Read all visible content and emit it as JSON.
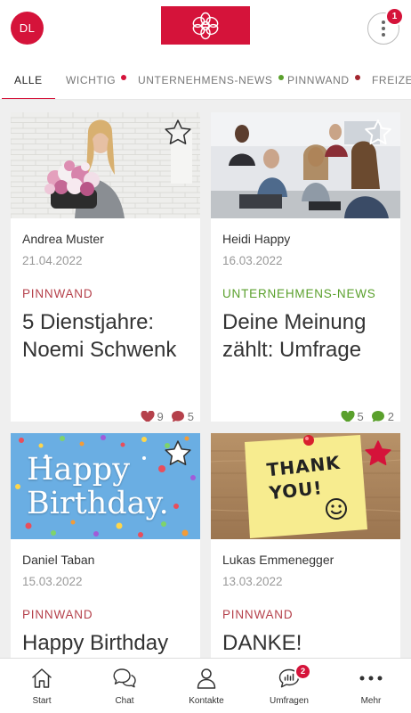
{
  "header": {
    "avatar_initials": "DL",
    "menu_badge": "1",
    "brand_color": "#d5133a"
  },
  "tabs": [
    {
      "label": "ALLE",
      "active": true
    },
    {
      "label": "WICHTIG",
      "dot_color": "#d5133a"
    },
    {
      "label": "UNTERNEHMENS-NEWS",
      "dot_color": "#5aa02c"
    },
    {
      "label": "PINNWAND",
      "dot_color": "#a3262f"
    },
    {
      "label": "FREIZEIT"
    }
  ],
  "posts": [
    {
      "author": "Andrea Muster",
      "date": "21.04.2022",
      "category": "PINNWAND",
      "category_color": "#b5414b",
      "title": "5 Dienstjahre: Noemi Schwenk",
      "likes": "9",
      "comments": "5",
      "reaction_color": "#b5414b",
      "starred": false,
      "image": "woman-with-flowers"
    },
    {
      "author": "Heidi Happy",
      "date": "16.03.2022",
      "category": "UNTERNEHMENS-NEWS",
      "category_color": "#5aa02c",
      "title": "Deine Meinung zählt: Umfrage",
      "likes": "5",
      "comments": "2",
      "reaction_color": "#5aa02c",
      "starred": false,
      "image": "team-meeting"
    },
    {
      "author": "Daniel Taban",
      "date": "15.03.2022",
      "category": "PINNWAND",
      "category_color": "#b5414b",
      "title": "Happy Birthday",
      "starred": false,
      "image": "happy-birthday-confetti",
      "image_text": [
        "Happy",
        "Birthday."
      ]
    },
    {
      "author": "Lukas Emmenegger",
      "date": "13.03.2022",
      "category": "PINNWAND",
      "category_color": "#b5414b",
      "title": "DANKE!",
      "starred": true,
      "image": "thank-you-sticky-note",
      "image_text": [
        "THANK",
        "YOU!"
      ]
    }
  ],
  "bottom_nav": [
    {
      "label": "Start",
      "icon": "home-icon"
    },
    {
      "label": "Chat",
      "icon": "chat-icon"
    },
    {
      "label": "Kontakte",
      "icon": "person-icon"
    },
    {
      "label": "Umfragen",
      "icon": "survey-icon",
      "badge": "2"
    },
    {
      "label": "Mehr",
      "icon": "more-icon"
    }
  ]
}
